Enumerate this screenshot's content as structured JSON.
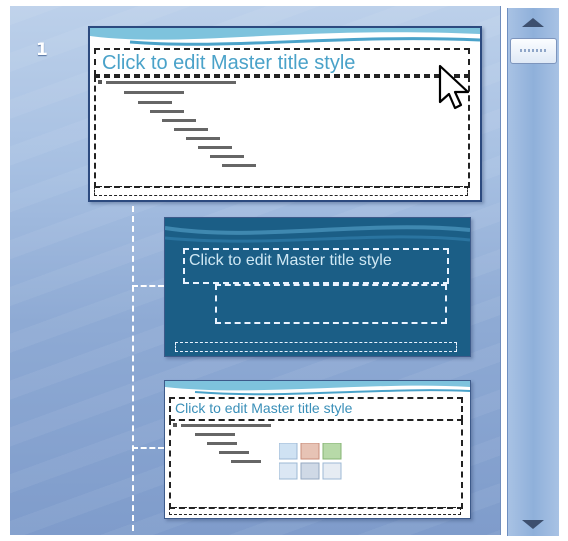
{
  "slides_pane": {
    "master": {
      "number": "1",
      "title_placeholder": "Click to edit Master title style"
    },
    "layouts": [
      {
        "title_placeholder": "Click to edit Master title style"
      },
      {
        "title_placeholder": "Click to edit Master title style"
      }
    ]
  },
  "scrollbar": {
    "up_icon": "scroll-up-arrow-icon",
    "down_icon": "scroll-down-arrow-icon"
  },
  "colors": {
    "pane_background": "#a7c0e2",
    "layout2_background": "#1b5e86",
    "title_text_master": "#4aa2c9"
  }
}
